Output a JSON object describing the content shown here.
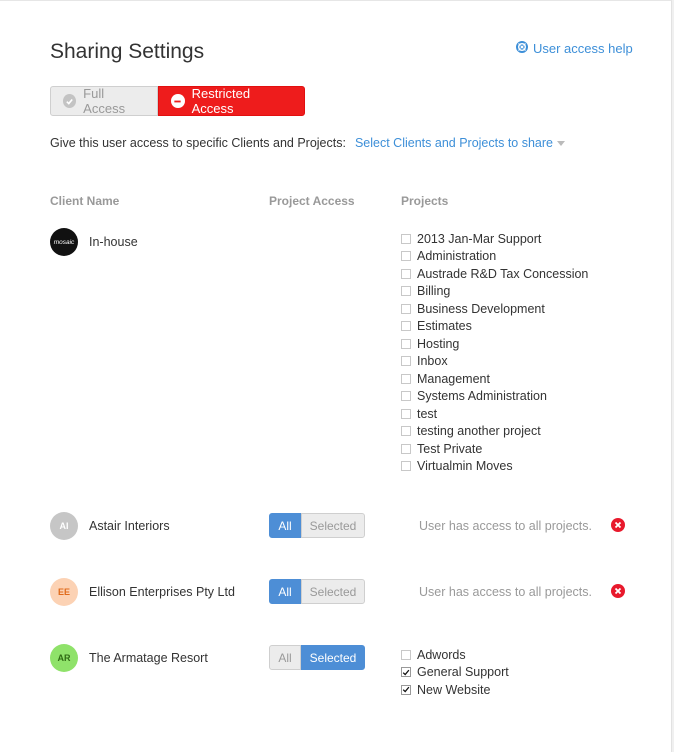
{
  "title": "Sharing Settings",
  "help_link": "User access help",
  "toggle": {
    "full": "Full Access",
    "restricted": "Restricted Access"
  },
  "description": "Give this user access to specific Clients and Projects:",
  "select_link": "Select Clients and Projects to share",
  "columns": {
    "client": "Client Name",
    "access": "Project Access",
    "projects": "Projects"
  },
  "seg_labels": {
    "all": "All",
    "selected": "Selected"
  },
  "all_access_message": "User has access to all projects.",
  "clients": [
    {
      "name": "In-house",
      "avatar": "mosaic",
      "projects": [
        {
          "name": "2013 Jan-Mar Support",
          "checked": false
        },
        {
          "name": "Administration",
          "checked": false
        },
        {
          "name": "Austrade R&D Tax Concession",
          "checked": false
        },
        {
          "name": "Billing",
          "checked": false
        },
        {
          "name": "Business Development",
          "checked": false
        },
        {
          "name": "Estimates",
          "checked": false
        },
        {
          "name": "Hosting",
          "checked": false
        },
        {
          "name": "Inbox",
          "checked": false
        },
        {
          "name": "Management",
          "checked": false
        },
        {
          "name": "Systems Administration",
          "checked": false
        },
        {
          "name": "test",
          "checked": false
        },
        {
          "name": "testing another project",
          "checked": false
        },
        {
          "name": "Test Private",
          "checked": false
        },
        {
          "name": "Virtualmin Moves",
          "checked": false
        }
      ]
    },
    {
      "name": "Astair Interiors",
      "avatar": "AI",
      "access": "All"
    },
    {
      "name": "Ellison Enterprises Pty Ltd",
      "avatar": "EE",
      "access": "All"
    },
    {
      "name": "The Armatage Resort",
      "avatar": "AR",
      "access": "Selected",
      "projects": [
        {
          "name": "Adwords",
          "checked": false
        },
        {
          "name": "General Support",
          "checked": true
        },
        {
          "name": "New Website",
          "checked": true
        }
      ]
    }
  ],
  "colors": {
    "accent": "#3d8fd8",
    "restricted": "#ee1c1c",
    "selected_blue": "#4d8ed6",
    "remove": "#e8192c"
  }
}
